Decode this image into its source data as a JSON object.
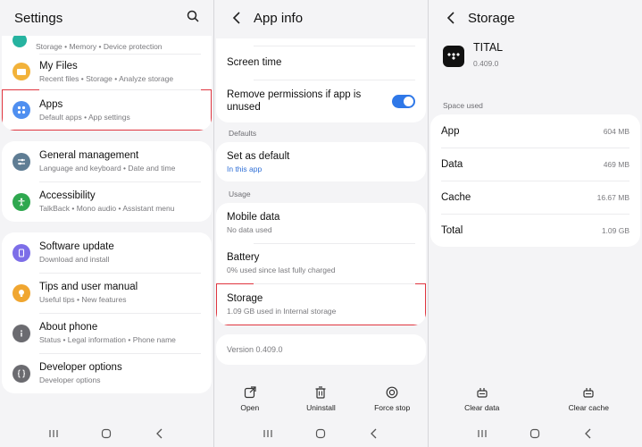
{
  "settings": {
    "title": "Settings",
    "top_row_subtitle": "Storage • Memory • Device protection",
    "items": [
      {
        "label": "My Files",
        "subtitle": "Recent files • Storage • Analyze storage",
        "color": "#f2b23a"
      },
      {
        "label": "Apps",
        "subtitle": "Default apps • App settings",
        "color": "#4f8ff0"
      },
      {
        "label": "General management",
        "subtitle": "Language and keyboard • Date and time",
        "color": "#5f7d94"
      },
      {
        "label": "Accessibility",
        "subtitle": "TalkBack • Mono audio • Assistant menu",
        "color": "#2fa84f"
      },
      {
        "label": "Software update",
        "subtitle": "Download and install",
        "color": "#7d6ee8"
      },
      {
        "label": "Tips and user manual",
        "subtitle": "Useful tips • New features",
        "color": "#f0a630"
      },
      {
        "label": "About phone",
        "subtitle": "Status • Legal information • Phone name",
        "color": "#6b6b70"
      },
      {
        "label": "Developer options",
        "subtitle": "Developer options",
        "color": "#6b6b70"
      }
    ]
  },
  "app_info": {
    "title": "App info",
    "screen_time": "Screen time",
    "remove_permissions": "Remove permissions if app is unused",
    "section_defaults": "Defaults",
    "set_default": "Set as default",
    "set_default_sub": "In this app",
    "section_usage": "Usage",
    "mobile_data": "Mobile data",
    "mobile_data_sub": "No data used",
    "battery": "Battery",
    "battery_sub": "0% used since last fully charged",
    "storage": "Storage",
    "storage_sub": "1.09 GB used in Internal storage",
    "version": "Version 0.409.0",
    "actions": {
      "open": "Open",
      "uninstall": "Uninstall",
      "force_stop": "Force stop"
    }
  },
  "storage": {
    "title": "Storage",
    "app_name": "TITAL",
    "app_version": "0.409.0",
    "section_space": "Space used",
    "rows": [
      {
        "label": "App",
        "value": "604 MB"
      },
      {
        "label": "Data",
        "value": "469 MB"
      },
      {
        "label": "Cache",
        "value": "16.67 MB"
      },
      {
        "label": "Total",
        "value": "1.09 GB"
      }
    ],
    "actions": {
      "clear_data": "Clear data",
      "clear_cache": "Clear cache"
    }
  },
  "colors": {
    "accent": "#2f78e8",
    "highlight": "#e0353f"
  }
}
